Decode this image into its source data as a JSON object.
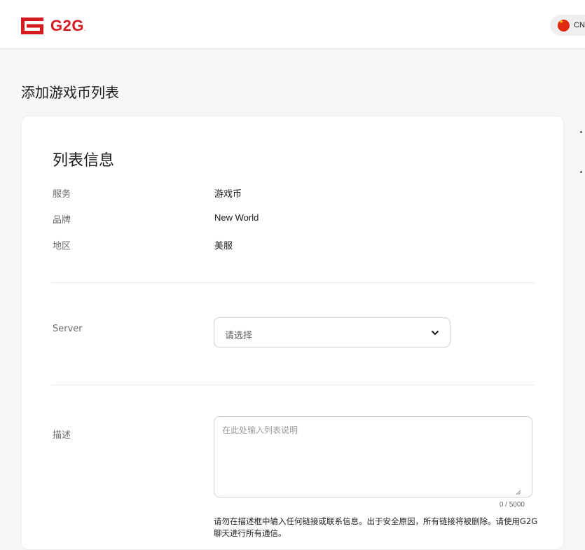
{
  "header": {
    "logo_text": "G2G",
    "logo_suffix": ".",
    "region_code": "CN"
  },
  "page": {
    "title": "添加游戏币列表"
  },
  "listing_info": {
    "title": "列表信息",
    "rows": [
      {
        "label": "服务",
        "value": "游戏币"
      },
      {
        "label": "品牌",
        "value": "New World"
      },
      {
        "label": "地区",
        "value": "美服"
      }
    ]
  },
  "server": {
    "label": "Server",
    "selected": "请选择"
  },
  "description": {
    "label": "描述",
    "placeholder": "在此处输入列表说明",
    "value": "",
    "counter": "0 / 5000",
    "warning": "请勿在描述框中输入任何链接或联系信息。出于安全原因，所有链接将被删除。请使用G2G聊天进行所有通信。"
  },
  "colors": {
    "brand": "#d71920",
    "background": "#f6f6f6",
    "card": "#ffffff"
  }
}
